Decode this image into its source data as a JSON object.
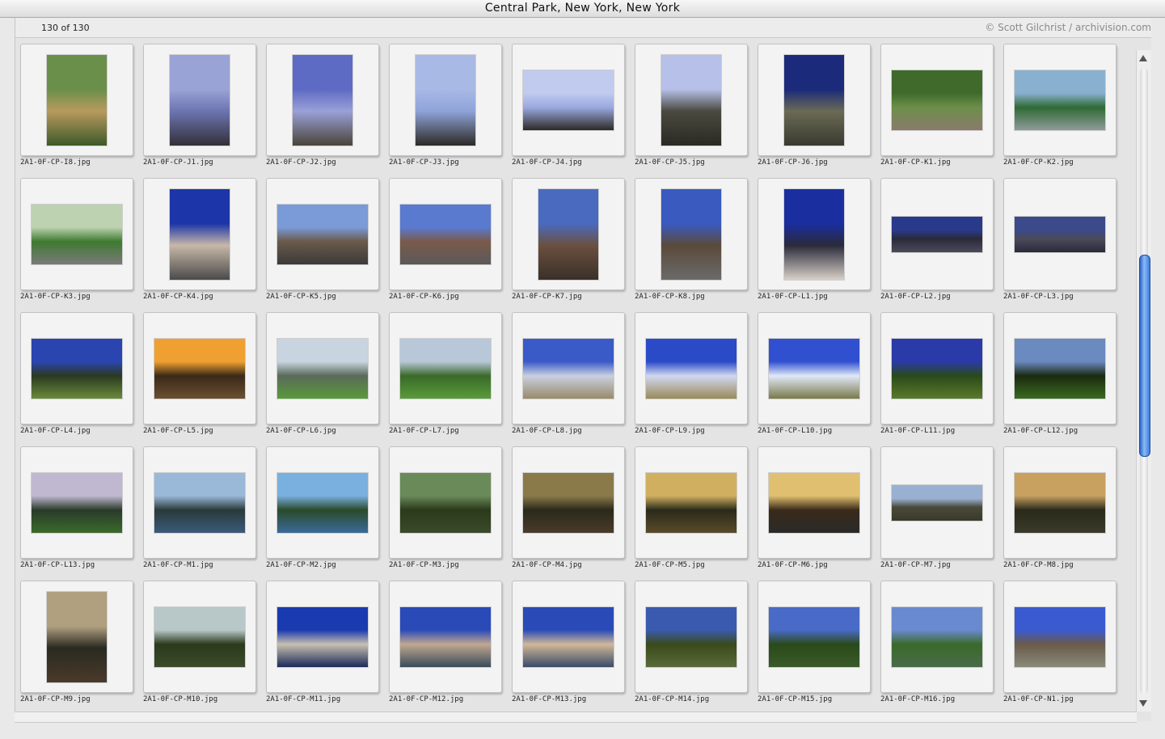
{
  "window": {
    "title": "Central Park, New York, New York",
    "count": "130 of 130",
    "credit": "© Scott Gilchrist / archivision.com"
  },
  "scrollbar": {
    "position_fraction": 0.44,
    "visible_fraction": 0.32
  },
  "photos": [
    {
      "file": "2A1-0F-CP-I8.jpg",
      "shape": "port",
      "colors": [
        "#6a8f4a",
        "#b89a5e",
        "#3d5a28"
      ]
    },
    {
      "file": "2A1-0F-CP-J1.jpg",
      "shape": "port",
      "colors": [
        "#9aa3d6",
        "#6c75b0",
        "#33303a"
      ]
    },
    {
      "file": "2A1-0F-CP-J2.jpg",
      "shape": "port",
      "colors": [
        "#5e6bc4",
        "#9aa0d8",
        "#4a4438"
      ]
    },
    {
      "file": "2A1-0F-CP-J3.jpg",
      "shape": "port",
      "colors": [
        "#a9b9e6",
        "#8fa3da",
        "#2c2a24"
      ]
    },
    {
      "file": "2A1-0F-CP-J4.jpg",
      "shape": "land",
      "colors": [
        "#c0cbee",
        "#9aa8e0",
        "#2c2a26"
      ]
    },
    {
      "file": "2A1-0F-CP-J5.jpg",
      "shape": "port",
      "colors": [
        "#b6c0e8",
        "#4a4a40",
        "#2a2a24"
      ]
    },
    {
      "file": "2A1-0F-CP-J6.jpg",
      "shape": "port",
      "colors": [
        "#1b2a7a",
        "#6a6a55",
        "#3a3a30"
      ]
    },
    {
      "file": "2A1-0F-CP-K1.jpg",
      "shape": "land",
      "colors": [
        "#3f6a2c",
        "#6c8f4a",
        "#8a7a6a"
      ]
    },
    {
      "file": "2A1-0F-CP-K2.jpg",
      "shape": "land",
      "colors": [
        "#8ab0d0",
        "#2f6a34",
        "#8f9a9a"
      ]
    },
    {
      "file": "2A1-0F-CP-K3.jpg",
      "shape": "land",
      "colors": [
        "#bcd2b0",
        "#3e7a30",
        "#7a7a7a"
      ]
    },
    {
      "file": "2A1-0F-CP-K4.jpg",
      "shape": "port",
      "colors": [
        "#1c35a8",
        "#c7b8a8",
        "#4a4a4a"
      ]
    },
    {
      "file": "2A1-0F-CP-K5.jpg",
      "shape": "land",
      "colors": [
        "#7a9ad8",
        "#6a5a4a",
        "#3a3a3a"
      ]
    },
    {
      "file": "2A1-0F-CP-K6.jpg",
      "shape": "land",
      "colors": [
        "#5a7ad0",
        "#7a5a4a",
        "#5a5a5a"
      ]
    },
    {
      "file": "2A1-0F-CP-K7.jpg",
      "shape": "port",
      "colors": [
        "#4a6ac0",
        "#6a5040",
        "#3a3028"
      ]
    },
    {
      "file": "2A1-0F-CP-K8.jpg",
      "shape": "port",
      "colors": [
        "#3a5ac0",
        "#5a4a3a",
        "#6a6a6a"
      ]
    },
    {
      "file": "2A1-0F-CP-L1.jpg",
      "shape": "port",
      "colors": [
        "#1a2ea0",
        "#2a2a3a",
        "#d8d0c8"
      ]
    },
    {
      "file": "2A1-0F-CP-L2.jpg",
      "shape": "pano",
      "colors": [
        "#2a3a8a",
        "#2a2a3a",
        "#4a4a5a"
      ]
    },
    {
      "file": "2A1-0F-CP-L3.jpg",
      "shape": "pano",
      "colors": [
        "#3a4a8a",
        "#4a4a5a",
        "#2a2a3a"
      ]
    },
    {
      "file": "2A1-0F-CP-L4.jpg",
      "shape": "land",
      "colors": [
        "#2a45b0",
        "#2a3a20",
        "#6a8a3a"
      ]
    },
    {
      "file": "2A1-0F-CP-L5.jpg",
      "shape": "land",
      "colors": [
        "#f0a030",
        "#3a2818",
        "#6a5030"
      ]
    },
    {
      "file": "2A1-0F-CP-L6.jpg",
      "shape": "land",
      "colors": [
        "#c8d4e0",
        "#5a6a5a",
        "#5a9a3a"
      ]
    },
    {
      "file": "2A1-0F-CP-L7.jpg",
      "shape": "land",
      "colors": [
        "#b8c8d8",
        "#3a6a2a",
        "#5a9a3a"
      ]
    },
    {
      "file": "2A1-0F-CP-L8.jpg",
      "shape": "land",
      "colors": [
        "#3a5ac8",
        "#c8d0e0",
        "#9a8a6a"
      ]
    },
    {
      "file": "2A1-0F-CP-L9.jpg",
      "shape": "land",
      "colors": [
        "#2a4ac8",
        "#d0d8f0",
        "#9a8a5a"
      ]
    },
    {
      "file": "2A1-0F-CP-L10.jpg",
      "shape": "land",
      "colors": [
        "#3050d0",
        "#e0e8f8",
        "#7a7a4a"
      ]
    },
    {
      "file": "2A1-0F-CP-L11.jpg",
      "shape": "land",
      "colors": [
        "#2a3aa8",
        "#2a4a1a",
        "#5a7a2a"
      ]
    },
    {
      "file": "2A1-0F-CP-L12.jpg",
      "shape": "land",
      "colors": [
        "#6a8ac0",
        "#1a2a10",
        "#3a6a20"
      ]
    },
    {
      "file": "2A1-0F-CP-L13.jpg",
      "shape": "land",
      "colors": [
        "#c0b8d0",
        "#2a3a2a",
        "#3a6a2a"
      ]
    },
    {
      "file": "2A1-0F-CP-M1.jpg",
      "shape": "land",
      "colors": [
        "#9ab8d8",
        "#2a3a3a",
        "#3a5a7a"
      ]
    },
    {
      "file": "2A1-0F-CP-M2.jpg",
      "shape": "land",
      "colors": [
        "#7ab0e0",
        "#2a4a2a",
        "#3a6a9a"
      ]
    },
    {
      "file": "2A1-0F-CP-M3.jpg",
      "shape": "land",
      "colors": [
        "#6a8a5a",
        "#2a3a1a",
        "#3a4a2a"
      ]
    },
    {
      "file": "2A1-0F-CP-M4.jpg",
      "shape": "land",
      "colors": [
        "#8a7a4a",
        "#2a2a1a",
        "#4a3a2a"
      ]
    },
    {
      "file": "2A1-0F-CP-M5.jpg",
      "shape": "land",
      "colors": [
        "#d0b060",
        "#2a2a1a",
        "#5a4a2a"
      ]
    },
    {
      "file": "2A1-0F-CP-M6.jpg",
      "shape": "land",
      "colors": [
        "#e0c070",
        "#3a2a1a",
        "#2a2a2a"
      ]
    },
    {
      "file": "2A1-0F-CP-M7.jpg",
      "shape": "pano",
      "colors": [
        "#9ab0d0",
        "#4a4a3a",
        "#3a3a2a"
      ]
    },
    {
      "file": "2A1-0F-CP-M8.jpg",
      "shape": "land",
      "colors": [
        "#c8a060",
        "#2a2a1a",
        "#3a3a2a"
      ]
    },
    {
      "file": "2A1-0F-CP-M9.jpg",
      "shape": "port",
      "colors": [
        "#b0a080",
        "#2a2a20",
        "#4a3a2a"
      ]
    },
    {
      "file": "2A1-0F-CP-M10.jpg",
      "shape": "land",
      "colors": [
        "#b8c8c8",
        "#2a3a1a",
        "#3a4a2a"
      ]
    },
    {
      "file": "2A1-0F-CP-M11.jpg",
      "shape": "land",
      "colors": [
        "#1a3ab0",
        "#c8c0b0",
        "#1a2a5a"
      ]
    },
    {
      "file": "2A1-0F-CP-M12.jpg",
      "shape": "land",
      "colors": [
        "#2a4ab8",
        "#c0a890",
        "#3a4a5a"
      ]
    },
    {
      "file": "2A1-0F-CP-M13.jpg",
      "shape": "land",
      "colors": [
        "#2a4ab8",
        "#d0b898",
        "#3a4a6a"
      ]
    },
    {
      "file": "2A1-0F-CP-M14.jpg",
      "shape": "land",
      "colors": [
        "#3a5ab0",
        "#3a4a1a",
        "#5a6a3a"
      ]
    },
    {
      "file": "2A1-0F-CP-M15.jpg",
      "shape": "land",
      "colors": [
        "#4a6ac8",
        "#2a4a1a",
        "#3a5a2a"
      ]
    },
    {
      "file": "2A1-0F-CP-M16.jpg",
      "shape": "land",
      "colors": [
        "#6a8ad0",
        "#3a6a2a",
        "#4a6a4a"
      ]
    },
    {
      "file": "2A1-0F-CP-N1.jpg",
      "shape": "land",
      "colors": [
        "#3a5ad0",
        "#6a5a4a",
        "#8a8a7a"
      ]
    }
  ]
}
